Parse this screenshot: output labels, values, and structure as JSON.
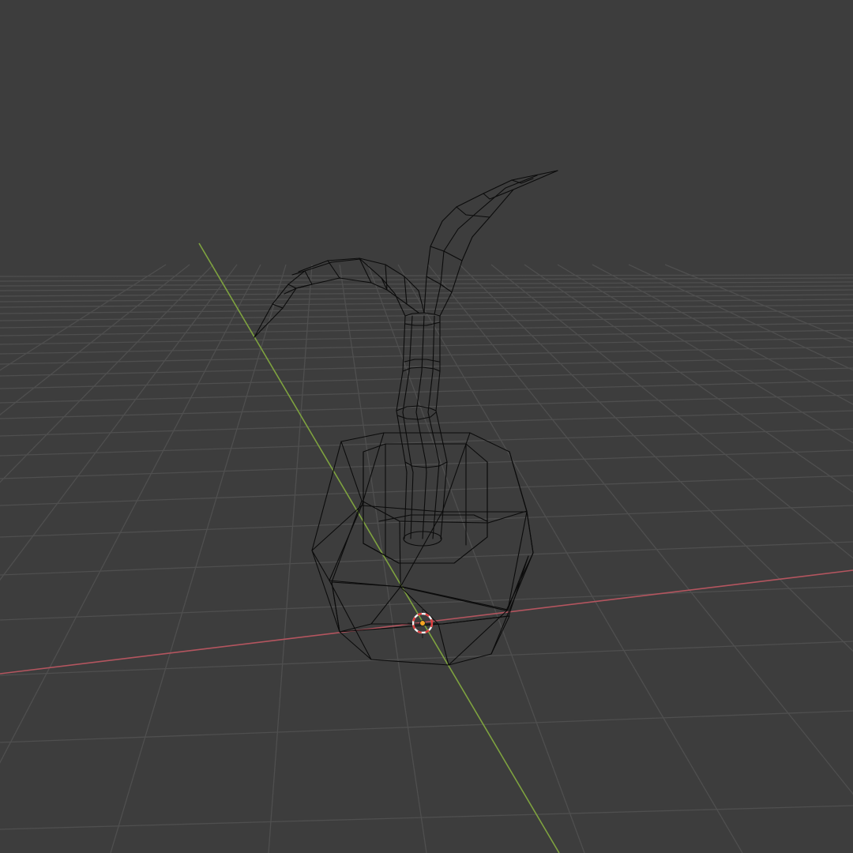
{
  "app": {
    "view": "3D Viewport",
    "shading": "wireframe"
  },
  "colors": {
    "background": "#3d3d3d",
    "grid": "#4f4f4f",
    "x_axis": "#b4555f",
    "y_axis": "#7ea23f",
    "wireframe": "#0b0b0b",
    "cursor_ring_red": "#e03c3c",
    "cursor_ring_white": "#f2f2f2",
    "object_origin": "#f5a623"
  },
  "scene": {
    "object": "potted-sprout-mesh",
    "parts": [
      "pot",
      "stem",
      "leaf-left",
      "leaf-right"
    ],
    "cursor_icon": "3d-cursor-icon",
    "origin_icon": "object-origin-icon"
  }
}
